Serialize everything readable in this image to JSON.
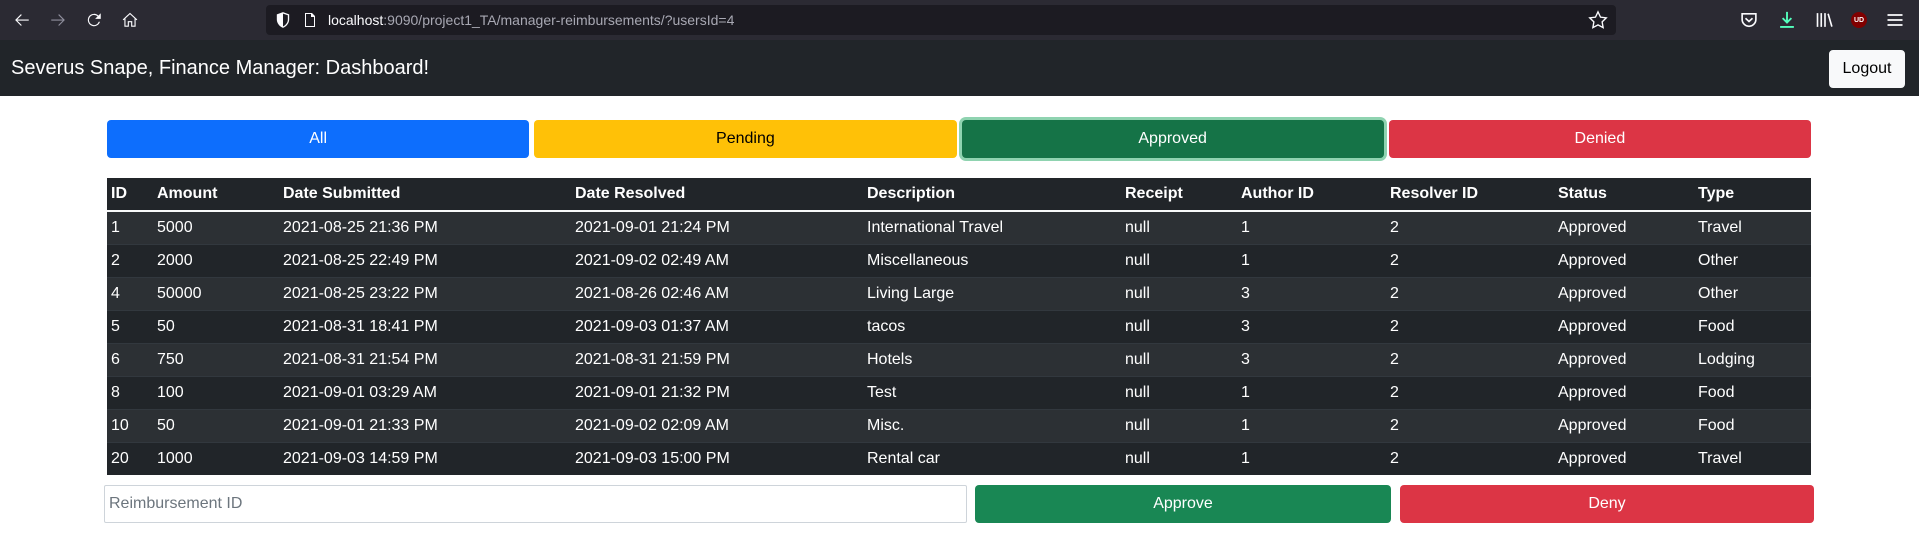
{
  "browser": {
    "url_host": "localhost",
    "url_rest": ":9090/project1_TA/manager-reimbursements/?usersId=4",
    "extension_badge": "UD"
  },
  "navbar": {
    "title": "Severus Snape, Finance Manager: Dashboard!",
    "logout_label": "Logout"
  },
  "filters": {
    "all": "All",
    "pending": "Pending",
    "approved": "Approved",
    "denied": "Denied"
  },
  "table": {
    "headers": [
      "ID",
      "Amount",
      "Date Submitted",
      "Date Resolved",
      "Description",
      "Receipt",
      "Author ID",
      "Resolver ID",
      "Status",
      "Type"
    ],
    "rows": [
      [
        "1",
        "5000",
        "2021-08-25 21:36 PM",
        "2021-09-01 21:24 PM",
        "International Travel",
        "null",
        "1",
        "2",
        "Approved",
        "Travel"
      ],
      [
        "2",
        "2000",
        "2021-08-25 22:49 PM",
        "2021-09-02 02:49 AM",
        "Miscellaneous",
        "null",
        "1",
        "2",
        "Approved",
        "Other"
      ],
      [
        "4",
        "50000",
        "2021-08-25 23:22 PM",
        "2021-08-26 02:46 AM",
        "Living Large",
        "null",
        "3",
        "2",
        "Approved",
        "Other"
      ],
      [
        "5",
        "50",
        "2021-08-31 18:41 PM",
        "2021-09-03 01:37 AM",
        "tacos",
        "null",
        "3",
        "2",
        "Approved",
        "Food"
      ],
      [
        "6",
        "750",
        "2021-08-31 21:54 PM",
        "2021-08-31 21:59 PM",
        "Hotels",
        "null",
        "3",
        "2",
        "Approved",
        "Lodging"
      ],
      [
        "8",
        "100",
        "2021-09-01 03:29 AM",
        "2021-09-01 21:32 PM",
        "Test",
        "null",
        "1",
        "2",
        "Approved",
        "Food"
      ],
      [
        "10",
        "50",
        "2021-09-01 21:33 PM",
        "2021-09-02 02:09 AM",
        "Misc.",
        "null",
        "1",
        "2",
        "Approved",
        "Food"
      ],
      [
        "20",
        "1000",
        "2021-09-03 14:59 PM",
        "2021-09-03 15:00 PM",
        "Rental car",
        "null",
        "1",
        "2",
        "Approved",
        "Travel"
      ]
    ]
  },
  "form": {
    "input_placeholder": "Reimbursement ID",
    "input_value": "",
    "approve_label": "Approve",
    "deny_label": "Deny"
  }
}
